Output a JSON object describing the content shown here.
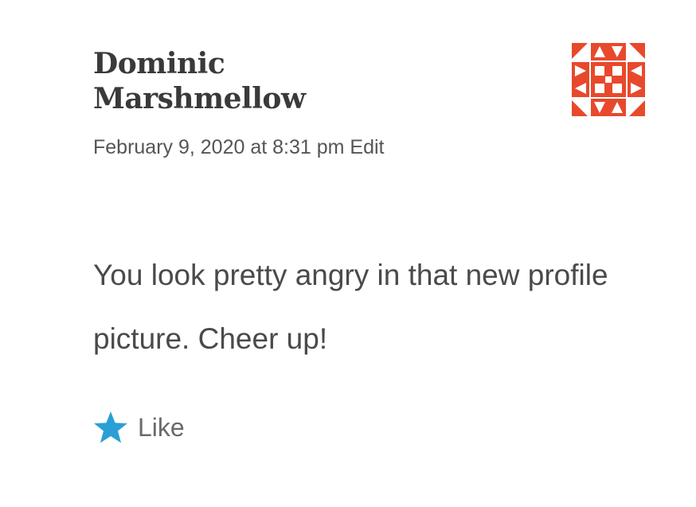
{
  "comment": {
    "author": "Dominic Marshmellow",
    "timestamp": "February 9, 2020 at 8:31 pm",
    "edit_label": "Edit",
    "body": "You look pretty angry in that new profile picture. Cheer up!",
    "like_label": "Like",
    "avatar_icon": "identicon-avatar",
    "like_icon": "star-icon"
  },
  "colors": {
    "avatar": "#e8492c",
    "like_star": "#2a9fd6",
    "author_text": "#3a3a3a",
    "body_text": "#4a4a4a"
  }
}
